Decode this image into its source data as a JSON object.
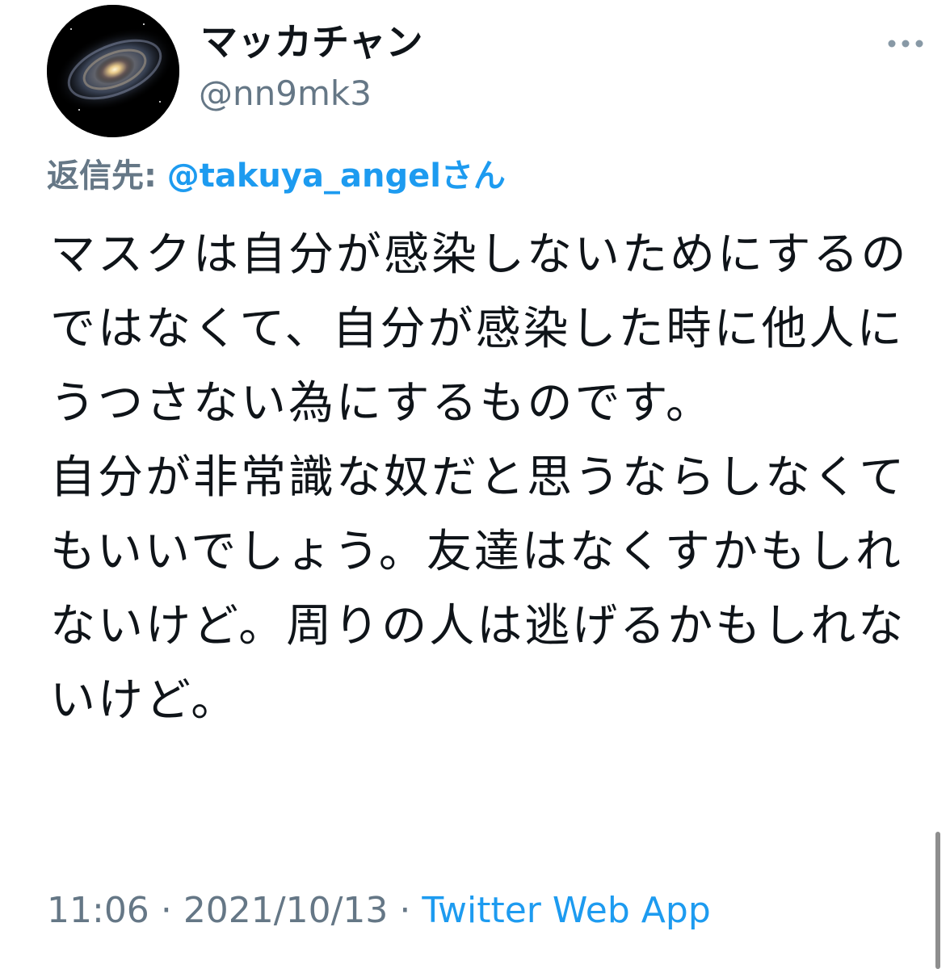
{
  "user": {
    "display_name": "マッカチャン",
    "handle": "@nn9mk3",
    "avatar_icon": "galaxy-avatar"
  },
  "reply": {
    "prefix": "返信先:",
    "to": "@takuya_angelさん"
  },
  "tweet": {
    "text": "マスクは自分が感染しないためにするのではなくて、自分が感染した時に他人にうつさない為にするものです。\n自分が非常識な奴だと思うならしなくてもいいでしょう。友達はなくすかもしれないけど。周りの人は逃げるかもしれないけど。"
  },
  "meta": {
    "time": "11:06",
    "separator": "·",
    "date": "2021/10/13",
    "source": "Twitter Web App"
  },
  "icons": {
    "more": "more-horizontal-icon"
  },
  "colors": {
    "text": "#0f1419",
    "secondary": "#657786",
    "link": "#1d9bf0"
  }
}
